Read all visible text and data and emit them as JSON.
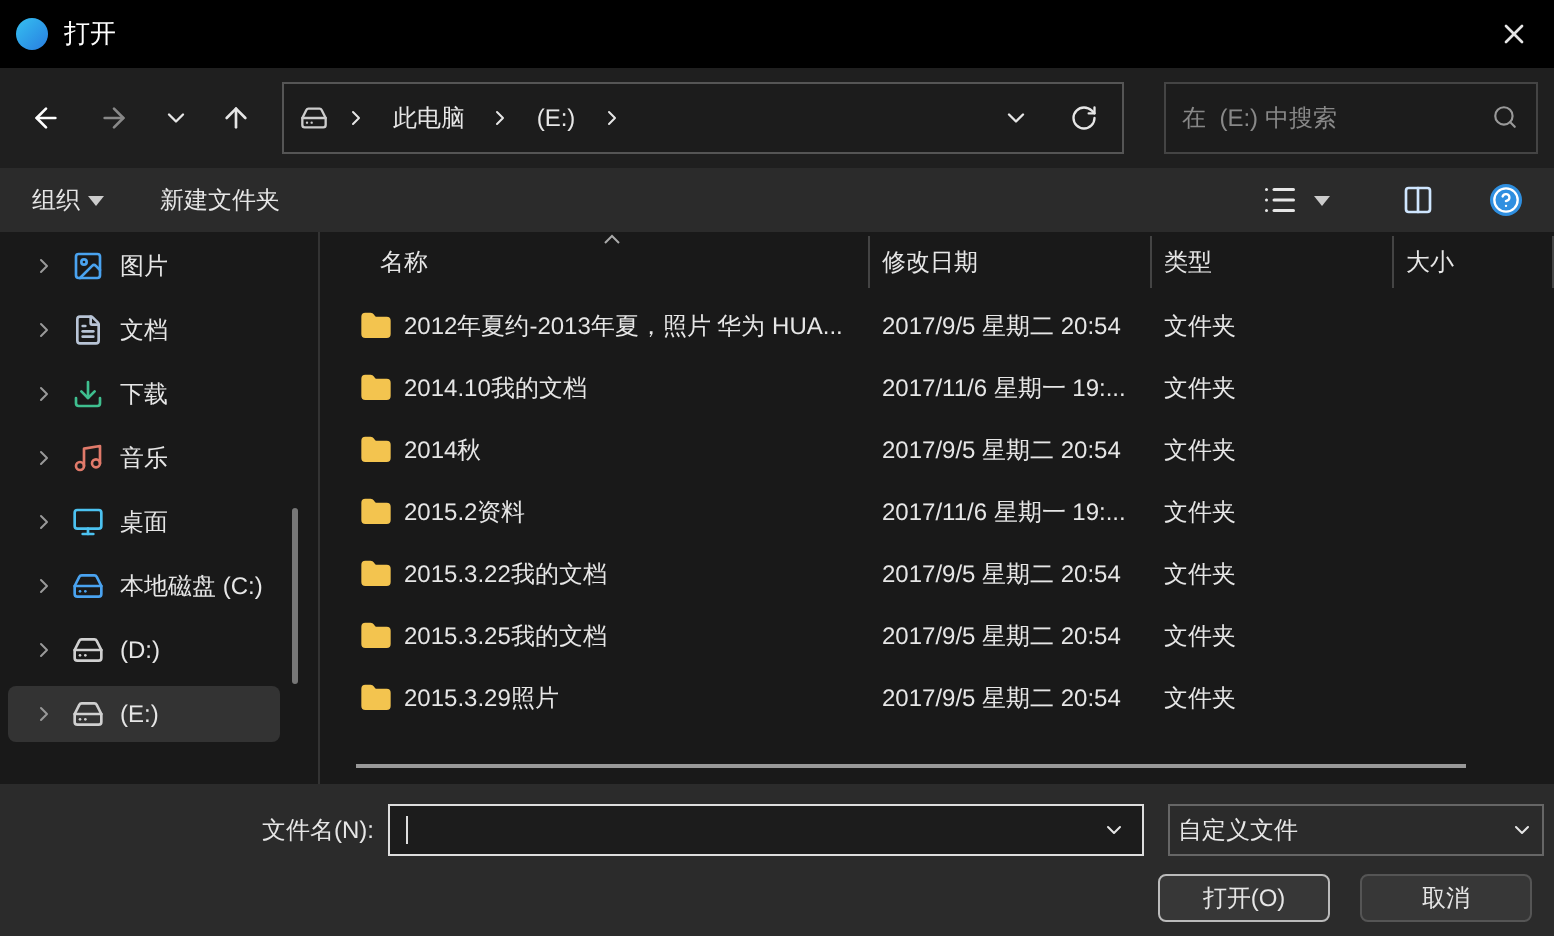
{
  "window": {
    "title": "打开"
  },
  "address": {
    "crumbs": [
      "此电脑",
      "(E:)"
    ]
  },
  "search": {
    "placeholder": "在  (E:) 中搜索"
  },
  "commands": [
    {
      "label": "组织",
      "dropdown": true
    },
    {
      "label": "新建文件夹",
      "dropdown": false
    }
  ],
  "sidebar": {
    "items": [
      {
        "label": "图片",
        "kind": "pictures",
        "selected": false
      },
      {
        "label": "文档",
        "kind": "documents",
        "selected": false
      },
      {
        "label": "下载",
        "kind": "downloads",
        "selected": false
      },
      {
        "label": "音乐",
        "kind": "music",
        "selected": false
      },
      {
        "label": "桌面",
        "kind": "desktop",
        "selected": false
      },
      {
        "label": "本地磁盘 (C:)",
        "kind": "system-drive",
        "selected": false
      },
      {
        "label": "(D:)",
        "kind": "drive",
        "selected": false
      },
      {
        "label": "(E:)",
        "kind": "drive",
        "selected": true
      }
    ]
  },
  "table": {
    "columns": [
      "名称",
      "修改日期",
      "类型",
      "大小"
    ],
    "rows": [
      {
        "name": "2012年夏约-2013年夏，照片 华为 HUA...",
        "modified": "2017/9/5 星期二 20:54",
        "type": "文件夹"
      },
      {
        "name": "2014.10我的文档",
        "modified": "2017/11/6 星期一 19:...",
        "type": "文件夹"
      },
      {
        "name": "2014秋",
        "modified": "2017/9/5 星期二 20:54",
        "type": "文件夹"
      },
      {
        "name": "2015.2资料",
        "modified": "2017/11/6 星期一 19:...",
        "type": "文件夹"
      },
      {
        "name": "2015.3.22我的文档",
        "modified": "2017/9/5 星期二 20:54",
        "type": "文件夹"
      },
      {
        "name": "2015.3.25我的文档",
        "modified": "2017/9/5 星期二 20:54",
        "type": "文件夹"
      },
      {
        "name": "2015.3.29照片",
        "modified": "2017/9/5 星期二 20:54",
        "type": "文件夹"
      }
    ]
  },
  "footer": {
    "filename_label": "文件名(N):",
    "filter": "自定义文件",
    "buttons": [
      "打开(O)",
      "取消"
    ]
  }
}
